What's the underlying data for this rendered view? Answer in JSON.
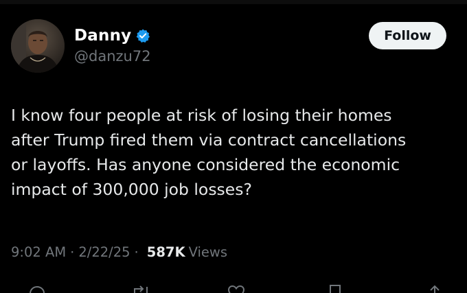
{
  "author": {
    "display_name": "Danny",
    "handle": "@danzu72",
    "verified": true
  },
  "follow_button": {
    "label": "Follow"
  },
  "tweet": {
    "text": "I know four people at risk of losing their homes\nafter Trump fired them via contract cancellations\nor layoffs. Has anyone considered the economic\nimpact of 300,000 job losses?"
  },
  "meta": {
    "time": "9:02 AM",
    "separator": "·",
    "date": "2/22/25",
    "views_count": "587K",
    "views_label": "Views"
  },
  "icons": {
    "verified": "verified-badge-icon",
    "reply": "reply-icon",
    "repost": "repost-icon",
    "like": "like-icon",
    "bookmark": "bookmark-icon",
    "share": "share-icon"
  },
  "colors": {
    "background": "#000000",
    "text": "#e7e9ea",
    "secondary": "#71767b",
    "verified_blue": "#1d9bf0",
    "follow_bg": "#eff3f4"
  }
}
